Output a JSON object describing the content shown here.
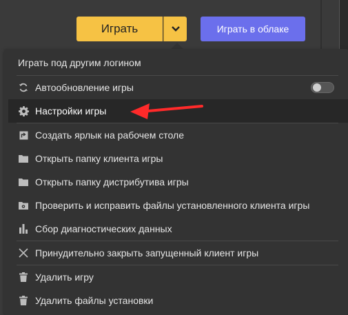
{
  "header": {
    "play_label": "Играть",
    "cloud_label": "Играть в облаке",
    "dropdown_icon": "chevron-down-icon"
  },
  "colors": {
    "play": "#f6c244",
    "cloud": "#6b6fec",
    "menu_bg": "#333333",
    "active_bg": "#272727",
    "annotation_arrow": "#ff2a2a"
  },
  "menu": {
    "items": [
      {
        "label": "Играть под другим логином",
        "icon": ""
      },
      {
        "label": "Автообновление игры",
        "icon": "refresh-icon",
        "toggle": false
      },
      {
        "label": "Настройки игры",
        "icon": "gear-icon",
        "active": true
      },
      {
        "label": "Создать ярлык на рабочем столе",
        "icon": "shortcut-icon"
      },
      {
        "label": "Открыть папку клиента игры",
        "icon": "folder-icon"
      },
      {
        "label": "Открыть папку дистрибутива игры",
        "icon": "folder-icon"
      },
      {
        "label": "Проверить и исправить файлы установленного клиента игры",
        "icon": "repair-folder-icon"
      },
      {
        "label": "Сбор диагностических данных",
        "icon": "bar-chart-icon"
      },
      {
        "label": "Принудительно закрыть запущенный клиент игры",
        "icon": "close-icon"
      },
      {
        "label": "Удалить игру",
        "icon": "trash-icon"
      },
      {
        "label": "Удалить файлы установки",
        "icon": "trash-icon"
      }
    ]
  }
}
